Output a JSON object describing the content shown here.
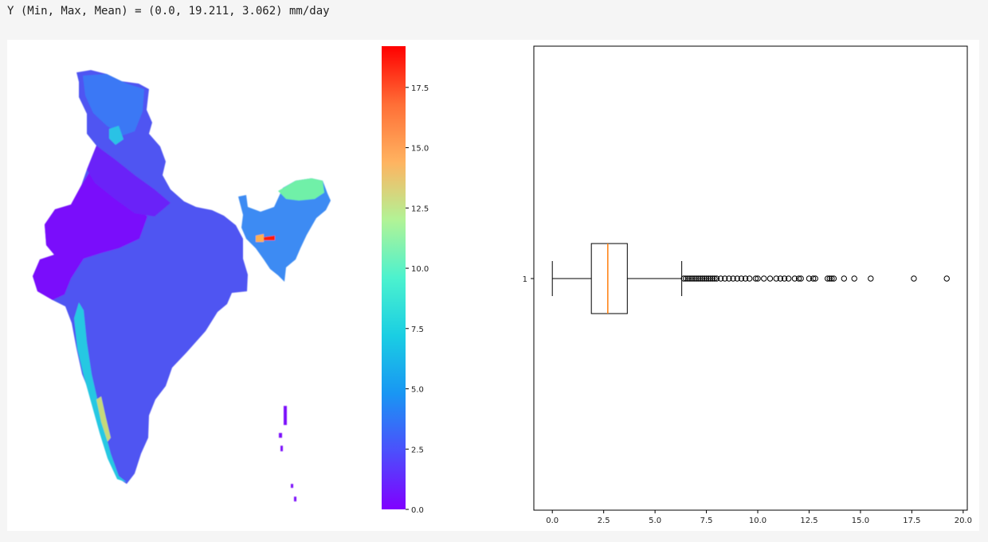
{
  "output": {
    "stats_line": "Y (Min, Max, Mean) = (0.0, 19.211, 3.062) mm/day"
  },
  "colors": {
    "colormap": "rainbow",
    "box_edge": "#000000",
    "median": "#ff7f0e"
  },
  "chart_data": [
    {
      "type": "heatmap",
      "description_region": "India",
      "colormap": "rainbow",
      "colorbar": {
        "range": [
          0.0,
          19.211
        ],
        "ticks": [
          0.0,
          2.5,
          5.0,
          7.5,
          10.0,
          12.5,
          15.0,
          17.5
        ],
        "tick_labels": [
          "0.0",
          "2.5",
          "5.0",
          "7.5",
          "10.0",
          "12.5",
          "15.0",
          "17.5"
        ]
      }
    },
    {
      "type": "boxplot",
      "orientation": "horizontal",
      "category_labels": [
        "1"
      ],
      "whisker_low": 0.0,
      "q1": 1.9,
      "median": 2.7,
      "q3": 3.65,
      "whisker_high": 6.3,
      "outliers": [
        6.4,
        6.5,
        6.6,
        6.7,
        6.8,
        6.9,
        7.0,
        7.1,
        7.2,
        7.3,
        7.4,
        7.5,
        7.6,
        7.7,
        7.8,
        7.9,
        8.0,
        8.2,
        8.4,
        8.6,
        8.8,
        9.0,
        9.2,
        9.4,
        9.6,
        9.9,
        10.0,
        10.3,
        10.6,
        10.9,
        11.1,
        11.3,
        11.5,
        11.8,
        12.0,
        12.1,
        12.5,
        12.7,
        12.8,
        13.4,
        13.5,
        13.6,
        13.7,
        14.2,
        14.7,
        15.5,
        17.6,
        19.2
      ],
      "xlim": [
        -0.9,
        20.2
      ],
      "xticks": [
        0.0,
        2.5,
        5.0,
        7.5,
        10.0,
        12.5,
        15.0,
        17.5,
        20.0
      ],
      "xtick_labels": [
        "0.0",
        "2.5",
        "5.0",
        "7.5",
        "10.0",
        "12.5",
        "15.0",
        "17.5",
        "20.0"
      ]
    }
  ]
}
